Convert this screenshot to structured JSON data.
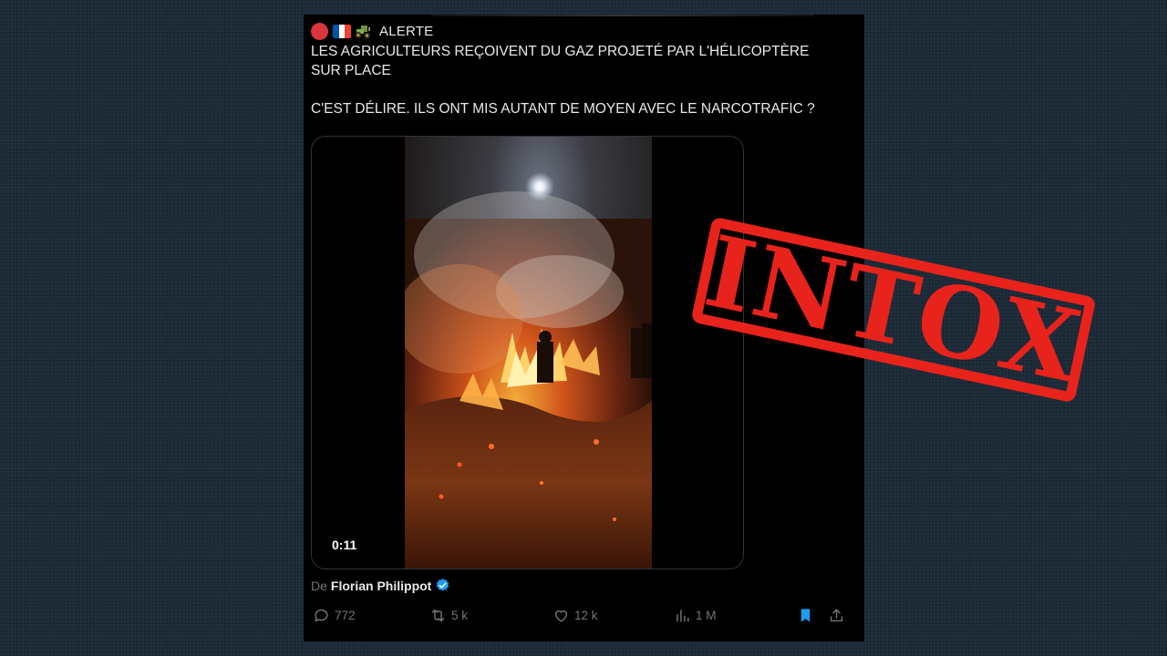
{
  "post": {
    "alert_label": "ALERTE",
    "line1": "LES AGRICULTEURS REÇOIVENT DU GAZ PROJETÉ PAR L'HÉLICOPTÈRE",
    "line2": "SUR PLACE",
    "line3": "C'EST DÉLIRE. ILS ONT MIS AUTANT DE MOYEN AVEC LE NARCOTRAFIC ?",
    "video_duration": "0:11",
    "byline_prefix": "De",
    "author_name": "Florian Philippot"
  },
  "actions": {
    "replies": "772",
    "reposts": "5 k",
    "likes": "12 k",
    "views": "1 M"
  },
  "stamp": {
    "label": "INTOX"
  },
  "colors": {
    "stamp_red": "#e8231c",
    "verified_blue": "#1d9bf0",
    "bookmark_blue": "#1d9bf0",
    "post_background": "#000000"
  },
  "icons": [
    "red-circle-icon",
    "french-flag-icon",
    "tractor-icon",
    "play-icon",
    "verified-badge-icon",
    "reply-icon",
    "repost-icon",
    "like-icon",
    "views-icon",
    "bookmark-icon",
    "share-icon"
  ]
}
